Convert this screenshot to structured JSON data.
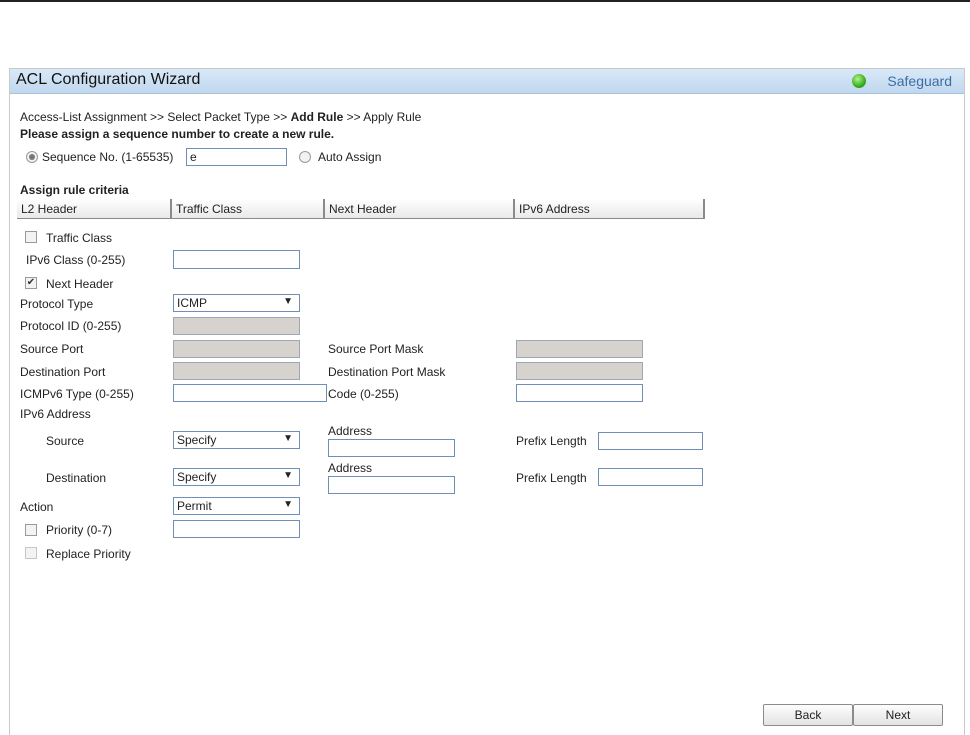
{
  "header": {
    "title": "ACL Configuration Wizard",
    "brand": "Safeguard"
  },
  "breadcrumb": {
    "step1": "Access-List Assignment >> Select Packet Type >> ",
    "current": "Add Rule",
    "step3": " >> Apply Rule"
  },
  "instruction": "Please assign a sequence number to create a new rule.",
  "sequence": {
    "label": "Sequence No. (1-65535)",
    "value": "e",
    "auto_label": "Auto Assign"
  },
  "criteria_heading": "Assign rule criteria",
  "tabs": [
    "L2 Header",
    "Traffic Class",
    "Next Header",
    "IPv6 Address"
  ],
  "traffic_class": {
    "label": "Traffic Class",
    "ipv6_class_label": "IPv6 Class (0-255)"
  },
  "next_header": {
    "label": "Next Header",
    "protocol_type_label": "Protocol Type",
    "protocol_type_value": "ICMP",
    "protocol_id_label": "Protocol ID (0-255)",
    "source_port_label": "Source Port",
    "source_port_mask_label": "Source Port Mask",
    "dest_port_label": "Destination Port",
    "dest_port_mask_label": "Destination Port Mask",
    "icmp_type_label": "ICMPv6 Type (0-255)",
    "code_label": "Code (0-255)"
  },
  "ipv6_address": {
    "label": "IPv6 Address",
    "source_label": "Source",
    "source_mode": "Specify",
    "destination_label": "Destination",
    "destination_mode": "Specify",
    "address_label": "Address",
    "prefix_label": "Prefix Length"
  },
  "action": {
    "label": "Action",
    "value": "Permit"
  },
  "priority": {
    "label": "Priority  (0-7)",
    "replace_label": "Replace Priority"
  },
  "buttons": {
    "back": "Back",
    "next": "Next"
  },
  "colors": {
    "title_bar": "#c9ddf2",
    "led": "#35b01e",
    "brand": "#3b6ea5"
  }
}
